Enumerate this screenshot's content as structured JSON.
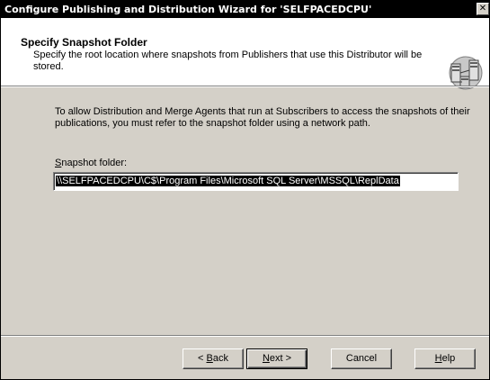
{
  "window": {
    "title": "Configure Publishing and Distribution Wizard for 'SELFPACEDCPU'",
    "close_glyph": "✕"
  },
  "header": {
    "title": "Specify Snapshot Folder",
    "description": "Specify the root location where snapshots from Publishers that use this Distributor will be stored.",
    "icon": "servers-icon"
  },
  "body": {
    "intro": "To allow Distribution and Merge Agents that run at Subscribers to access the snapshots of their publications, you must refer to the snapshot folder using a network path.",
    "snapshot_label_accel": "S",
    "snapshot_label_rest": "napshot folder:",
    "snapshot_value": "\\\\SELFPACEDCPU\\C$\\Program Files\\Microsoft SQL Server\\MSSQL\\ReplData"
  },
  "buttons": {
    "back_prefix": "< ",
    "back_accel": "B",
    "back_rest": "ack",
    "next_accel": "N",
    "next_rest": "ext >",
    "cancel": "Cancel",
    "help_accel": "H",
    "help_rest": "elp"
  },
  "colors": {
    "titlebar": "#000000",
    "dialog": "#d4d0c8",
    "header": "#ffffff",
    "selection": "#000000"
  }
}
